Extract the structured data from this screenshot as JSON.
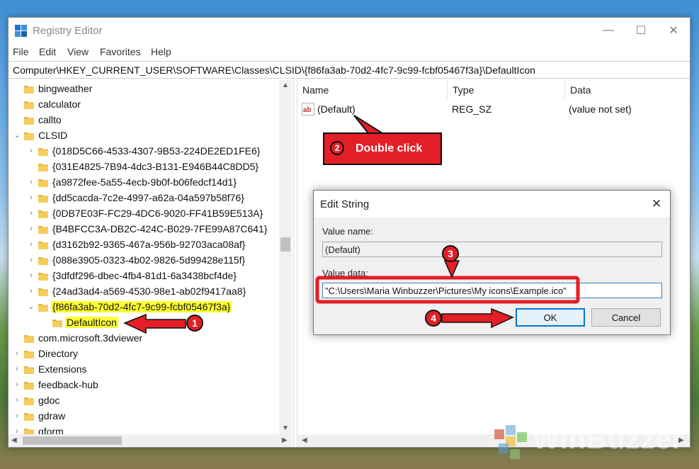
{
  "window": {
    "title": "Registry Editor",
    "controls": {
      "minimize": "—",
      "maximize": "☐",
      "close": "✕"
    }
  },
  "menu": [
    "File",
    "Edit",
    "View",
    "Favorites",
    "Help"
  ],
  "address": "Computer\\HKEY_CURRENT_USER\\SOFTWARE\\Classes\\CLSID\\{f86fa3ab-70d2-4fc7-9c99-fcbf05467f3a}\\DefaultIcon",
  "tree": {
    "items": [
      {
        "label": "bingweather",
        "chevron": ""
      },
      {
        "label": "calculator",
        "chevron": ""
      },
      {
        "label": "callto",
        "chevron": ""
      },
      {
        "label": "CLSID",
        "chevron": "⌄"
      },
      {
        "label": "{018D5C66-4533-4307-9B53-224DE2ED1FE6}",
        "chevron": "›"
      },
      {
        "label": "{031E4825-7B94-4dc3-B131-E946B44C8DD5}",
        "chevron": ""
      },
      {
        "label": "{a9872fee-5a55-4ecb-9b0f-b06fedcf14d1}",
        "chevron": "›"
      },
      {
        "label": "{dd5cacda-7c2e-4997-a62a-04a597b58f76}",
        "chevron": "›"
      },
      {
        "label": "{0DB7E03F-FC29-4DC6-9020-FF41B59E513A}",
        "chevron": "›"
      },
      {
        "label": "{B4BFCC3A-DB2C-424C-B029-7FE99A87C641}",
        "chevron": "›"
      },
      {
        "label": "{d3162b92-9365-467a-956b-92703aca08af}",
        "chevron": "›"
      },
      {
        "label": "{088e3905-0323-4b02-9826-5d99428e115f}",
        "chevron": "›"
      },
      {
        "label": "{3dfdf296-dbec-4fb4-81d1-6a3438bcf4de}",
        "chevron": "›"
      },
      {
        "label": "{24ad3ad4-a569-4530-98e1-ab02f9417aa8}",
        "chevron": "›"
      },
      {
        "label": "{f86fa3ab-70d2-4fc7-9c99-fcbf05467f3a}",
        "chevron": "⌄"
      },
      {
        "label": "DefaultIcon",
        "chevron": ""
      },
      {
        "label": "com.microsoft.3dviewer",
        "chevron": ""
      },
      {
        "label": "Directory",
        "chevron": "›"
      },
      {
        "label": "Extensions",
        "chevron": "›"
      },
      {
        "label": "feedback-hub",
        "chevron": "›"
      },
      {
        "label": "gdoc",
        "chevron": "›"
      },
      {
        "label": "gdraw",
        "chevron": "›"
      },
      {
        "label": "gform",
        "chevron": "›"
      }
    ]
  },
  "list": {
    "columns": [
      "Name",
      "Type",
      "Data"
    ],
    "rows": [
      {
        "name": "(Default)",
        "type": "REG_SZ",
        "data": "(value not set)",
        "icon": "ab-string-icon"
      }
    ]
  },
  "dialog": {
    "title": "Edit String",
    "value_name_label": "Value name:",
    "value_name": "(Default)",
    "value_data_label": "Value data:",
    "value_data": "\"C:\\Users\\Maria Winbuzzer\\Pictures\\My icons\\Example.ico\"",
    "ok": "OK",
    "cancel": "Cancel",
    "close": "✕"
  },
  "annotations": {
    "callout": "Double click",
    "badges": [
      "1",
      "2",
      "3",
      "4"
    ]
  },
  "watermark": "WinBuzzer",
  "colors": {
    "annotation_red": "#e41e26",
    "highlight_yellow": "#ffff33",
    "folder_yellow": "#e8b33a",
    "accent_blue": "#0078d7"
  }
}
